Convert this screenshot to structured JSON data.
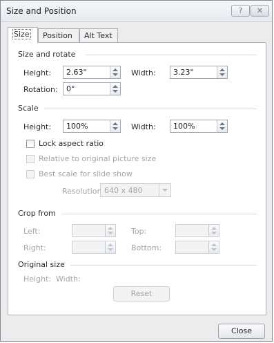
{
  "window": {
    "title": "Size and Position",
    "help_glyph": "?",
    "close_glyph": "✕"
  },
  "tabs": [
    {
      "label": "Size"
    },
    {
      "label": "Position"
    },
    {
      "label": "Alt Text"
    }
  ],
  "size_rotate": {
    "header": "Size and rotate",
    "height_label": "Height:",
    "height_value": "2.63\"",
    "width_label": "Width:",
    "width_value": "3.23\"",
    "rotation_label": "Rotation:",
    "rotation_value": "0°"
  },
  "scale": {
    "header": "Scale",
    "height_label": "Height:",
    "height_value": "100%",
    "width_label": "Width:",
    "width_value": "100%",
    "lock_aspect": "Lock aspect ratio",
    "relative_original": "Relative to original picture size",
    "best_scale": "Best scale for slide show",
    "resolution_label": "Resolution",
    "resolution_value": "640 x 480"
  },
  "crop": {
    "header": "Crop from",
    "left_label": "Left:",
    "top_label": "Top:",
    "right_label": "Right:",
    "bottom_label": "Bottom:"
  },
  "original": {
    "header": "Original size",
    "height_label": "Height:",
    "width_label": "Width:",
    "reset_label": "Reset"
  },
  "footer": {
    "close_label": "Close"
  }
}
